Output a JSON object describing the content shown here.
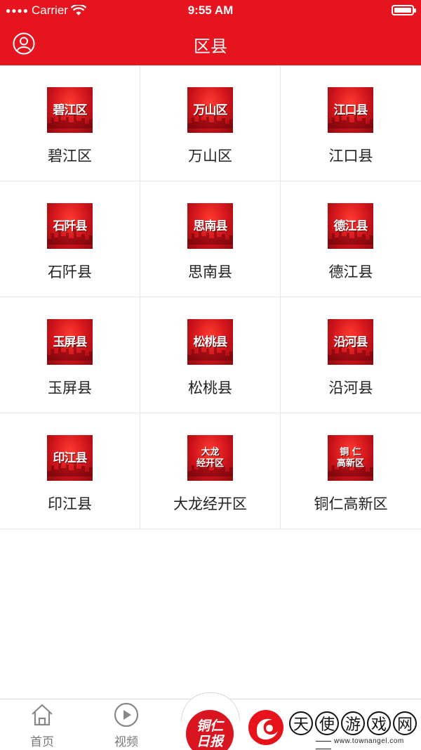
{
  "status_bar": {
    "carrier": "Carrier",
    "time": "9:55 AM"
  },
  "navbar": {
    "title": "区县"
  },
  "colors": {
    "brand_red": "#e5141f",
    "tile_red": "#d0141b",
    "label_text": "#222222",
    "tab_text": "#777777"
  },
  "districts": [
    {
      "label": "碧江区",
      "tile_text": "碧江区"
    },
    {
      "label": "万山区",
      "tile_text": "万山区"
    },
    {
      "label": "江口县",
      "tile_text": "江口县"
    },
    {
      "label": "石阡县",
      "tile_text": "石阡县"
    },
    {
      "label": "思南县",
      "tile_text": "思南县"
    },
    {
      "label": "德江县",
      "tile_text": "德江县"
    },
    {
      "label": "玉屏县",
      "tile_text": "玉屏县"
    },
    {
      "label": "松桃县",
      "tile_text": "松桃县"
    },
    {
      "label": "沿河县",
      "tile_text": "沿河县"
    },
    {
      "label": "印江县",
      "tile_text": "印江县"
    },
    {
      "label": "大龙经开区",
      "tile_text": "大龙\n经开区"
    },
    {
      "label": "铜仁高新区",
      "tile_text": "铜 仁\n高新区"
    }
  ],
  "tabbar": {
    "home": {
      "label": "首页",
      "icon": "home-icon"
    },
    "video": {
      "label": "视频",
      "icon": "play-icon"
    },
    "center": {
      "label": "铜仁\n日报",
      "icon": "tongren-daily-logo"
    }
  },
  "watermark": {
    "chars": [
      "天",
      "使",
      "游",
      "戏",
      "网"
    ],
    "url": "www.townangel.com"
  }
}
